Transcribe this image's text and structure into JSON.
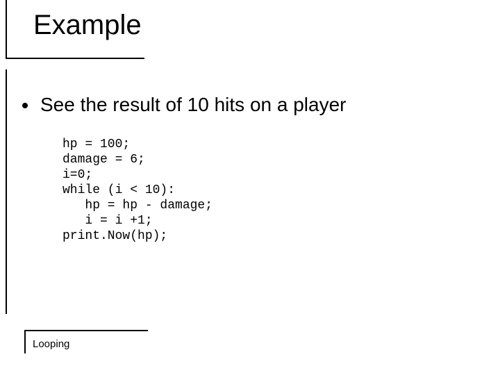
{
  "slide": {
    "title": "Example",
    "bullet": "See the result of 10 hits on a player",
    "code": "hp = 100;\ndamage = 6;\ni=0;\nwhile (i < 10):\n   hp = hp - damage;\n   i = i +1;\nprint.Now(hp);",
    "footer": "Looping"
  }
}
